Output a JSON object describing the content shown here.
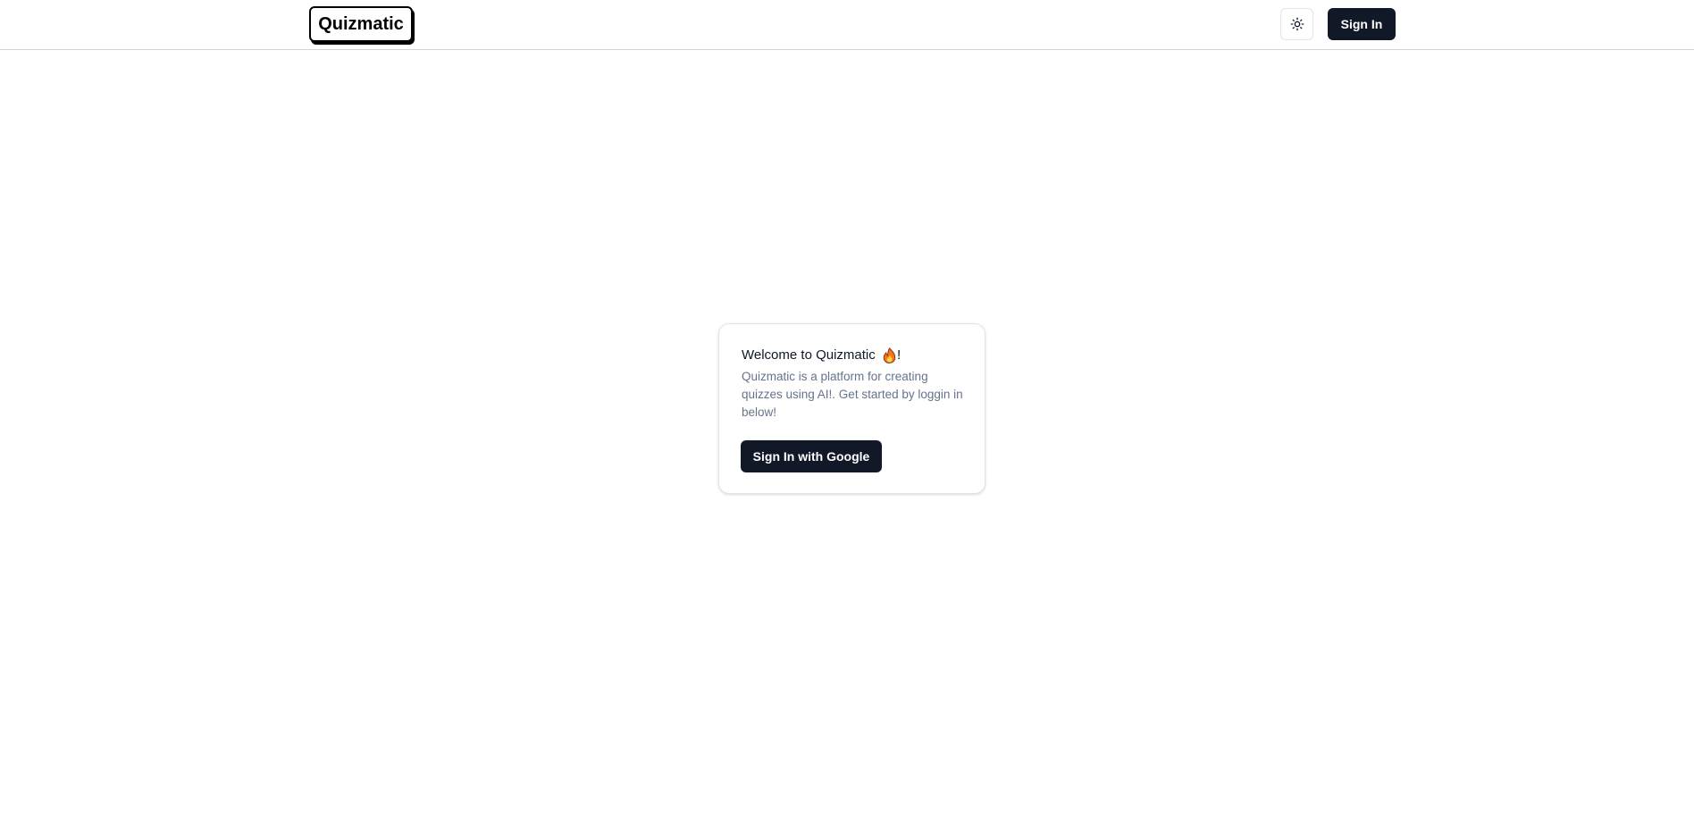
{
  "header": {
    "logo_text": "Quizmatic",
    "theme_toggle_icon": "sun-icon",
    "signin_label": "Sign In"
  },
  "card": {
    "title_prefix": "Welcome to Quizmatic ",
    "title_icon": "flame-icon",
    "title_suffix": "!",
    "description": "Quizmatic is a platform for creating quizzes using AI!. Get started by loggin in below!",
    "google_button_label": "Sign In with Google"
  },
  "colors": {
    "primary_button": "#111827",
    "border": "#e4e4e7",
    "muted_text": "#64748b",
    "flame": "#f97316"
  }
}
